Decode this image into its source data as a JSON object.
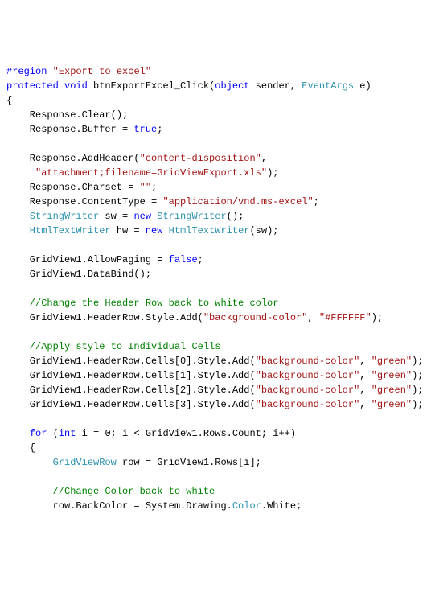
{
  "code": {
    "line1_region": "#region",
    "line1_str": " \"Export to excel\"",
    "line2_protected": "protected",
    "line2_void": " void",
    "line2_method": " btnExportExcel_Click(",
    "line2_object": "object",
    "line2_sender": " sender, ",
    "line2_eventargs": "EventArgs",
    "line2_e": " e)",
    "line3": "{",
    "line4": "    Response.Clear();",
    "line5a": "    Response.Buffer = ",
    "line5_true": "true",
    "line5b": ";",
    "line7a": "    Response.AddHeader(",
    "line7_str1": "\"content-disposition\"",
    "line7b": ",",
    "line8a": "     ",
    "line8_str": "\"attachment;filename=GridViewExport.xls\"",
    "line8b": ");",
    "line9a": "    Response.Charset = ",
    "line9_str": "\"\"",
    "line9b": ";",
    "line10a": "    Response.ContentType = ",
    "line10_str": "\"application/vnd.ms-excel\"",
    "line10b": ";",
    "line11_type": "    StringWriter",
    "line11a": " sw = ",
    "line11_new": "new",
    "line11_type2": " StringWriter",
    "line11b": "();",
    "line12_type": "    HtmlTextWriter",
    "line12a": " hw = ",
    "line12_new": "new",
    "line12_type2": " HtmlTextWriter",
    "line12b": "(sw);",
    "line14a": "    GridView1.AllowPaging = ",
    "line14_false": "false",
    "line14b": ";",
    "line15": "    GridView1.DataBind();",
    "line17_comment": "    //Change the Header Row back to white color",
    "line18a": "    GridView1.HeaderRow.Style.Add(",
    "line18_str1": "\"background-color\"",
    "line18b": ", ",
    "line18_str2": "\"#FFFFFF\"",
    "line18c": ");",
    "line20_comment": "    //Apply style to Individual Cells",
    "line21a": "    GridView1.HeaderRow.Cells[0].Style.Add(",
    "line21_str1": "\"background-color\"",
    "line21b": ", ",
    "line21_str2": "\"green\"",
    "line21c": ");",
    "line22a": "    GridView1.HeaderRow.Cells[1].Style.Add(",
    "line22_str1": "\"background-color\"",
    "line22b": ", ",
    "line22_str2": "\"green\"",
    "line22c": ");",
    "line23a": "    GridView1.HeaderRow.Cells[2].Style.Add(",
    "line23_str1": "\"background-color\"",
    "line23b": ", ",
    "line23_str2": "\"green\"",
    "line23c": ");",
    "line24a": "    GridView1.HeaderRow.Cells[3].Style.Add(",
    "line24_str1": "\"background-color\"",
    "line24b": ", ",
    "line24_str2": "\"green\"",
    "line24c": ");",
    "line26a": "    ",
    "line26_for": "for",
    "line26b": " (",
    "line26_int": "int",
    "line26c": " i = 0; i < GridView1.Rows.Count; i++)",
    "line27": "    {",
    "line28a": "        ",
    "line28_type": "GridViewRow",
    "line28b": " row = GridView1.Rows[i];",
    "line30_comment": "        //Change Color back to white",
    "line31a": "        row.BackColor = System.Drawing.",
    "line31_type": "Color",
    "line31b": ".White;"
  }
}
